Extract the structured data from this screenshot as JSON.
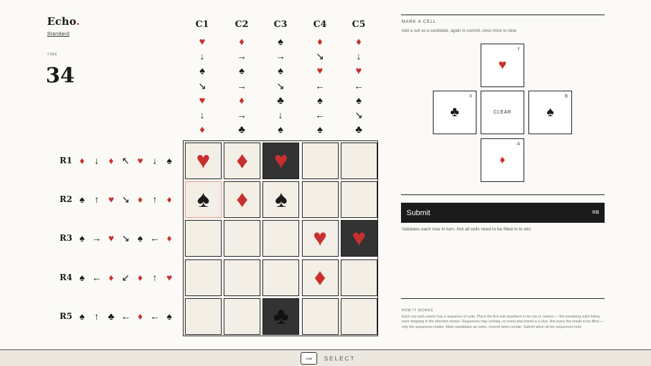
{
  "brand": {
    "name": "Echo",
    "dot": ".",
    "mode": "Standard"
  },
  "timer": {
    "label": "TIME",
    "value": "34"
  },
  "columns": [
    {
      "label": "C1",
      "clues": [
        "heart",
        "down",
        "spade",
        "down-right",
        "heart",
        "down",
        "diamond"
      ]
    },
    {
      "label": "C2",
      "clues": [
        "diamond",
        "right",
        "spade",
        "right",
        "diamond",
        "right",
        "club"
      ]
    },
    {
      "label": "C3",
      "clues": [
        "spade",
        "right",
        "spade",
        "down-right",
        "club",
        "down",
        "spade"
      ]
    },
    {
      "label": "C4",
      "clues": [
        "diamond",
        "down-right",
        "heart",
        "left",
        "spade",
        "left",
        "spade"
      ]
    },
    {
      "label": "C5",
      "clues": [
        "diamond",
        "down",
        "heart",
        "left",
        "spade",
        "down-right",
        "club"
      ]
    }
  ],
  "rows": [
    {
      "label": "R1",
      "clues": [
        "diamond",
        "down",
        "diamond",
        "up-left",
        "heart",
        "down",
        "spade"
      ]
    },
    {
      "label": "R2",
      "clues": [
        "spade",
        "up",
        "heart",
        "down-right",
        "diamond",
        "up",
        "diamond"
      ]
    },
    {
      "label": "R3",
      "clues": [
        "spade",
        "right",
        "heart",
        "down-right",
        "spade",
        "left",
        "diamond"
      ]
    },
    {
      "label": "R4",
      "clues": [
        "spade",
        "left",
        "diamond",
        "down-left",
        "diamond",
        "up",
        "heart"
      ]
    },
    {
      "label": "R5",
      "clues": [
        "spade",
        "up",
        "club",
        "left",
        "diamond",
        "left",
        "spade"
      ]
    }
  ],
  "board": [
    [
      {
        "s": "heart",
        "st": "light"
      },
      {
        "s": "diamond",
        "st": "light"
      },
      {
        "s": "heart",
        "st": "dark"
      },
      {
        "s": "",
        "st": "light"
      },
      {
        "s": "",
        "st": "light"
      }
    ],
    [
      {
        "s": "spade",
        "st": "selected"
      },
      {
        "s": "diamond",
        "st": "light"
      },
      {
        "s": "spade",
        "st": "light"
      },
      {
        "s": "",
        "st": "light"
      },
      {
        "s": "",
        "st": "light"
      }
    ],
    [
      {
        "s": "",
        "st": "light"
      },
      {
        "s": "",
        "st": "light"
      },
      {
        "s": "",
        "st": "light"
      },
      {
        "s": "heart",
        "st": "light"
      },
      {
        "s": "heart",
        "st": "dark"
      }
    ],
    [
      {
        "s": "",
        "st": "light"
      },
      {
        "s": "",
        "st": "light"
      },
      {
        "s": "",
        "st": "light"
      },
      {
        "s": "diamond",
        "st": "light"
      },
      {
        "s": "",
        "st": "light"
      }
    ],
    [
      {
        "s": "",
        "st": "light"
      },
      {
        "s": "",
        "st": "light"
      },
      {
        "s": "club",
        "st": "dark"
      },
      {
        "s": "",
        "st": "light"
      },
      {
        "s": "",
        "st": "light"
      }
    ]
  ],
  "panel": {
    "title": "MARK A CELL",
    "hint": "Add a suit as a candidate, again to commit, once more to clear",
    "keys": {
      "y": {
        "label": "Y",
        "suit": "heart"
      },
      "x": {
        "label": "X",
        "suit": "club"
      },
      "clear": {
        "text": "CLEAR"
      },
      "b": {
        "label": "B",
        "suit": "spade"
      },
      "a": {
        "label": "A",
        "suit": "diamond"
      }
    },
    "submit": {
      "label": "Submit",
      "hint": "RB"
    },
    "validate": "Validates each clue in turn. Not all cells need to be filled in to win.",
    "how_title": "HOW IT WORKS",
    "how_text": "Each row and column has a sequence of suits. Place the first suit anywhere in its row or column — the remaining suits follow, each stepping in the direction shown. Sequences may overlap, so every placement is a clue. Not every the needs to be filled — only the sequences matter. Mark candidates as notes, commit when certain. Submit when all ten sequences hold."
  },
  "footer": {
    "button": "LMB",
    "action": "SELECT"
  },
  "colors": {
    "red": "#c8302f",
    "black": "#1b1b1b",
    "cell": "#f3efe6",
    "dark_cell": "#333333"
  }
}
